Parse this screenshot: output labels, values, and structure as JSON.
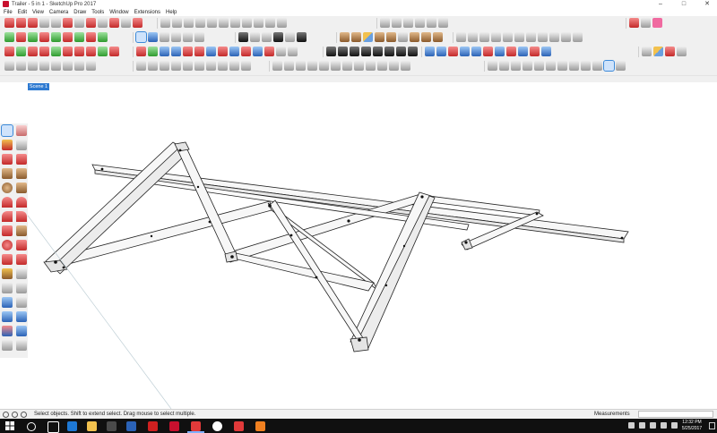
{
  "window": {
    "title": "Trailer - 5 in 1 - SketchUp Pro 2017",
    "minimize_glyph": "–",
    "maximize_glyph": "□",
    "close_glyph": "✕"
  },
  "menu": [
    "File",
    "Edit",
    "View",
    "Camera",
    "Draw",
    "Tools",
    "Window",
    "Extensions",
    "Help"
  ],
  "scene_tab": "Scene 1",
  "status": {
    "hint": "Select objects. Shift to extend select. Drag mouse to select multiple.",
    "measurements_label": "Measurements",
    "measurements_value": ""
  },
  "taskbar": {
    "time": "12:32 PM",
    "date": "5/25/2017"
  },
  "colors": {
    "toolbar_bg": "#f0f0f0",
    "scene_tab_bg": "#2e7ad1",
    "taskbar_bg": "#101010",
    "model_edge": "#222222",
    "model_face": "#f7f7f7"
  },
  "icons": {
    "left_toolbar": [
      "select-arrow-icon",
      "eraser-icon",
      "paint-bucket-icon",
      "pencil-line-icon",
      "rectangle-icon",
      "circle-icon",
      "arc-icon",
      "push-pull-icon",
      "move-icon",
      "rotate-icon",
      "scale-icon",
      "offset-icon",
      "tape-measure-icon",
      "text-icon",
      "orbit-icon",
      "pan-icon",
      "zoom-icon",
      "zoom-extents-icon",
      "walk-icon",
      "look-around-icon"
    ]
  }
}
